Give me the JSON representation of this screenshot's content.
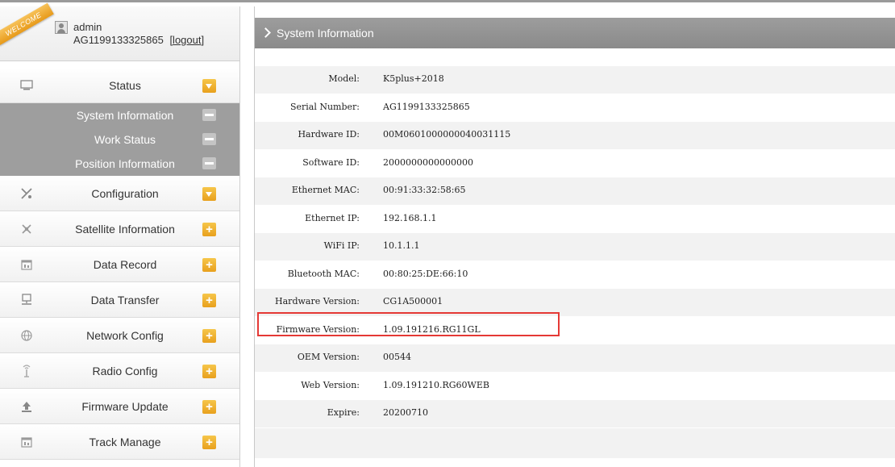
{
  "user": {
    "ribbon": "WELCOME",
    "name": "admin",
    "id": "AG1199133325865",
    "logout": "[logout]"
  },
  "menu": {
    "status": "Status",
    "status_sub": [
      "System Information",
      "Work Status",
      "Position Information"
    ],
    "items": [
      {
        "label": "Configuration",
        "icon": "wrench-icon",
        "toggle": "collapse"
      },
      {
        "label": "Satellite Information",
        "icon": "satellite-icon",
        "toggle": "+"
      },
      {
        "label": "Data Record",
        "icon": "calendar-icon",
        "toggle": "+"
      },
      {
        "label": "Data Transfer",
        "icon": "network-icon",
        "toggle": "+"
      },
      {
        "label": "Network Config",
        "icon": "globe-icon",
        "toggle": "+"
      },
      {
        "label": "Radio Config",
        "icon": "antenna-icon",
        "toggle": "+"
      },
      {
        "label": "Firmware Update",
        "icon": "upload-icon",
        "toggle": "+"
      },
      {
        "label": "Track Manage",
        "icon": "calendar-icon",
        "toggle": "+"
      }
    ]
  },
  "main": {
    "title": "System Information",
    "rows": [
      {
        "k": "Model:",
        "v": "K5plus+2018"
      },
      {
        "k": "Serial Number:",
        "v": "AG1199133325865"
      },
      {
        "k": "Hardware ID:",
        "v": "00M0601000000040031115"
      },
      {
        "k": "Software ID:",
        "v": "2000000000000000"
      },
      {
        "k": "Ethernet MAC:",
        "v": "00:91:33:32:58:65"
      },
      {
        "k": "Ethernet IP:",
        "v": "192.168.1.1"
      },
      {
        "k": "WiFi IP:",
        "v": "10.1.1.1"
      },
      {
        "k": "Bluetooth MAC:",
        "v": "00:80:25:DE:66:10"
      },
      {
        "k": "Hardware Version:",
        "v": "CG1A500001"
      },
      {
        "k": "Firmware Version:",
        "v": "1.09.191216.RG11GL"
      },
      {
        "k": "OEM Version:",
        "v": "00544"
      },
      {
        "k": "Web Version:",
        "v": "1.09.191210.RG60WEB"
      },
      {
        "k": "Expire:",
        "v": "20200710"
      }
    ]
  },
  "colors": {
    "accent_toggle": "#f0b030",
    "submenu_bg": "#9e9e9e",
    "title_bar": "#939393",
    "highlight": "#e53935"
  }
}
